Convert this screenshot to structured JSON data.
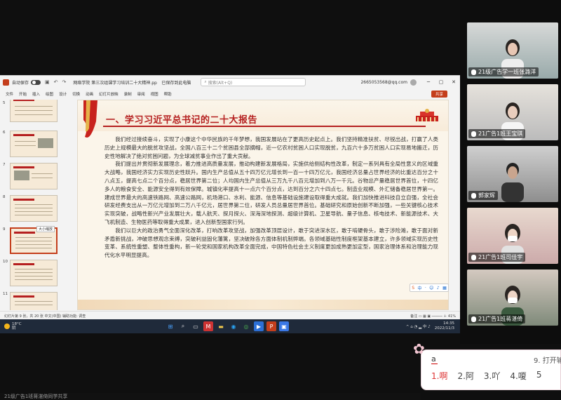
{
  "titlebar": {
    "autosave": "自动保存",
    "filename": "网络学院 第三次组课学习培训二十大精神.pptx",
    "saved": "已保存到此电脑",
    "search_placeholder": "搜索(Alt+Q)",
    "user": "2665053568@qq.com"
  },
  "menu": [
    "文件",
    "开始",
    "插入",
    "绘图",
    "设计",
    "切换",
    "动画",
    "幻灯片放映",
    "录制",
    "审阅",
    "视图",
    "帮助"
  ],
  "share_label": "共享",
  "thumbnails": {
    "numbers": [
      "5",
      "6",
      "7",
      "8",
      "9",
      "10",
      "11"
    ],
    "selected": "9",
    "tooltip": "大小缩放"
  },
  "slide": {
    "title": "一、学习习近平总书记的二十大报告",
    "paragraphs": [
      "我们经过接续奋斗，实现了小康这个中华民族的千年梦想，我国发展站在了更高历史起点上。我们坚持精准扶贫、尽锐出战，打赢了人类历史上规模最大的脱贫攻坚战，全国八百三十二个贫困县全部摘帽，近一亿农村贫困人口实现脱贫，九百六十多万贫困人口实现易地搬迁，历史性地解决了绝对贫困问题，为全球减贫事业作出了重大贡献。",
      "我们提出并贯彻新发展理念，着力推进高质量发展，推动构建新发展格局，实施供给侧结构性改革，制定一系列具有全局性意义的区域重大战略，我国经济实力实现历史性跃升。国内生产总值从五十四万亿元增长到一百一十四万亿元，我国经济总量占世界经济的比重达百分之十八点五，提高七点二个百分点，稳居世界第二位；人均国内生产总值从三万九千八百元增加到八万一千元。谷物总产量稳居世界首位，十四亿多人的粮食安全、能源安全得到有效保障。城镇化率提高十一点六个百分点，达到百分之六十四点七。制造业规模、外汇储备稳居世界第一。建成世界最大的高速铁路网、高速公路网，机场港口、水利、能源、信息等基础设施建设取得重大成就。我们加快推进科技自立自强，全社会研发经费支出从一万亿元增加到二万八千亿元，居世界第二位，研发人员总量居世界首位。基础研究和原始创新不断加强，一些关键核心技术实现突破，战略性新兴产业发展壮大，载人航天、探月探火、深海深地探测、超级计算机、卫星导航、量子信息、核电技术、新能源技术、大飞机制造、生物医药等取得重大成果，进入创新型国家行列。",
      "我们以巨大的政治勇气全面深化改革，打响改革攻坚战，加强改革顶层设计，敢于突进深水区，敢于啃硬骨头，敢于涉险滩，敢于面对新矛盾新挑战，冲破思想观念束缚，突破利益固化藩篱，坚决破除各方面体制机制弊端。各领域基础性制度框架基本建立，许多领域实现历史性变革、系统性重塑、整体性重构，新一轮党和国家机构改革全面完成，中国特色社会主义制度更加成熟更加定型，国家治理体系和治理能力现代化水平明显提高。"
    ]
  },
  "statusbar": {
    "left": "幻灯片第 9 张，共 20 张    中文(中国)    辅助功能: 调查",
    "right": "备注    ▭  ▦  ▣  ─────  ＋  41%"
  },
  "taskbar": {
    "temp": "18°C",
    "weather": "阴",
    "time": "14:35",
    "date": "2022/11/3"
  },
  "participants": [
    {
      "name": "21级广告学一班张潞洋"
    },
    {
      "name": "21广告1班王宝琪"
    },
    {
      "name": "郭家辉"
    },
    {
      "name": "21广告1班司佳宇"
    },
    {
      "name": "21广告1班蒋湛倚"
    }
  ],
  "ime": {
    "input": "a",
    "hint": "9. 打开输",
    "candidates": [
      "1.啊",
      "2.阿",
      "3.吖",
      "4.嗄",
      "5"
    ]
  },
  "bottom_text": "21级广告1班蒋湛倚同学共享"
}
